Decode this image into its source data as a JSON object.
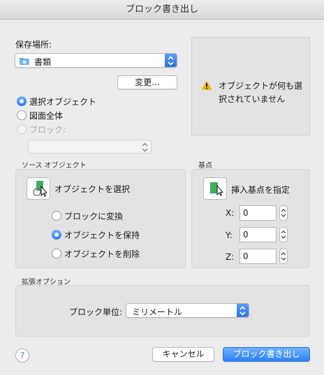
{
  "window": {
    "title": "ブロック書き出し"
  },
  "location": {
    "label": "保存場所:",
    "folder": "書類",
    "change_button": "変更..."
  },
  "preview": {
    "warning": "オブジェクトが何も選択されていません",
    "warning_line1": "オブジェクトが何も選",
    "warning_line2": "択されていません"
  },
  "source_mode": {
    "options": [
      {
        "label": "選択オブジェクト",
        "selected": true,
        "enabled": true
      },
      {
        "label": "図面全体",
        "selected": false,
        "enabled": true
      },
      {
        "label": "ブロック:",
        "selected": false,
        "enabled": false
      }
    ],
    "block_select_value": ""
  },
  "source_objects": {
    "title": "ソース オブジェクト",
    "select_button": "オブジェクトを選択",
    "options": [
      {
        "label": "ブロックに変換",
        "selected": false
      },
      {
        "label": "オブジェクトを保持",
        "selected": true
      },
      {
        "label": "オブジェクトを削除",
        "selected": false
      }
    ]
  },
  "base_point": {
    "title": "基点",
    "pick_button": "挿入基点を指定",
    "x_label": "X:",
    "x_value": "0",
    "y_label": "Y:",
    "y_value": "0",
    "z_label": "Z:",
    "z_value": "0"
  },
  "extended": {
    "title": "拡張オプション",
    "unit_label": "ブロック単位:",
    "unit_value": "ミリメートル"
  },
  "footer": {
    "help": "?",
    "cancel": "キャンセル",
    "export": "ブロック書き出し"
  },
  "colors": {
    "accent": "#2f7ff5",
    "warning": "#f0b400",
    "block_icon": "#3dae5a"
  }
}
